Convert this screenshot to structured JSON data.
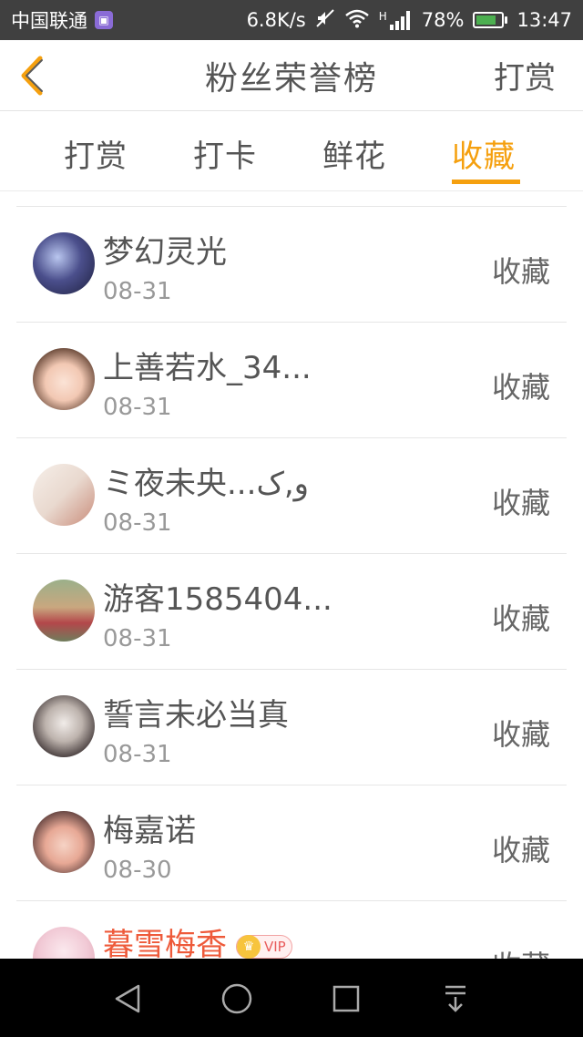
{
  "status_bar": {
    "carrier": "中国联通",
    "speed": "6.8K/s",
    "network": "H",
    "battery": "78%",
    "time": "13:47"
  },
  "header": {
    "title": "粉丝荣誉榜",
    "action": "打赏"
  },
  "tabs": [
    {
      "label": "打赏",
      "active": false
    },
    {
      "label": "打卡",
      "active": false
    },
    {
      "label": "鲜花",
      "active": false
    },
    {
      "label": "收藏",
      "active": true
    }
  ],
  "list": [
    {
      "name": "梦幻灵光",
      "date": "08-31",
      "action": "收藏"
    },
    {
      "name": "上善若水_34...",
      "date": "08-31",
      "action": "收藏"
    },
    {
      "name": "ミ夜未央...ﻭ,ک",
      "date": "08-31",
      "action": "收藏"
    },
    {
      "name": "游客1585404...",
      "date": "08-31",
      "action": "收藏"
    },
    {
      "name": "誓言未必当真",
      "date": "08-31",
      "action": "收藏"
    },
    {
      "name": "梅嘉诺",
      "date": "08-30",
      "action": "收藏"
    },
    {
      "name": "暮雪梅香",
      "date": "",
      "action": "收藏",
      "badge": "VIP"
    }
  ],
  "colors": {
    "accent": "#f5a00f",
    "vip_name": "#ee5a3a"
  }
}
